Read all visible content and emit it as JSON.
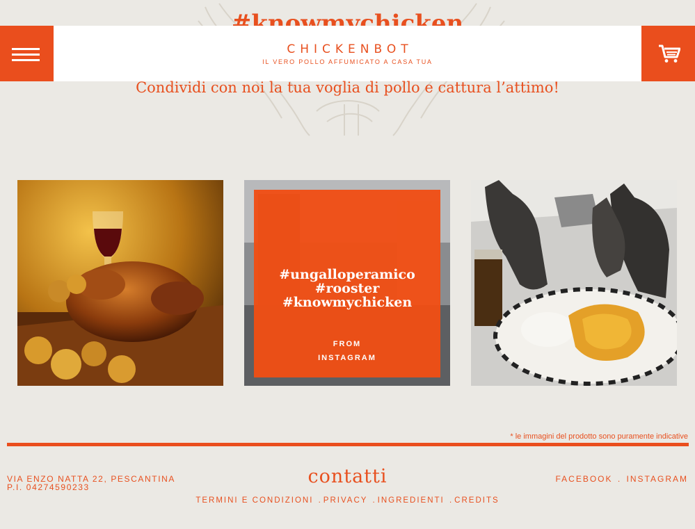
{
  "background": {
    "hashtag": "#knowmychicken"
  },
  "header": {
    "brand_name": "CHICKENBOT",
    "brand_subtitle": "IL VERO POLLO AFFUMICATO A CASA TUA",
    "menu_icon": "hamburger-menu-icon",
    "cart_icon": "cart-icon"
  },
  "tagline": "Condividi con noi la tua voglia di pollo e cattura l’attimo!",
  "gallery": {
    "overlay": {
      "tags": [
        "#ungalloperamico",
        "#rooster",
        "#knowmychicken"
      ],
      "from_line1": "FROM",
      "from_line2": "INSTAGRAM"
    }
  },
  "footer": {
    "disclaimer": "* le immagini del prodotto sono puramente indicative",
    "address_line1": "VIA ENZO NATTA 22, PESCANTINA",
    "address_line2": "P.I. 04274590233",
    "contacts_title": "contatti",
    "social": [
      "FACEBOOK",
      "INSTAGRAM"
    ],
    "links": [
      "TERMINI E CONDIZIONI",
      "PRIVACY",
      "INGREDIENTI",
      "CREDITS"
    ]
  },
  "colors": {
    "accent": "#ea4e1d",
    "background": "#ebe9e4",
    "header_bg": "#ffffff"
  }
}
